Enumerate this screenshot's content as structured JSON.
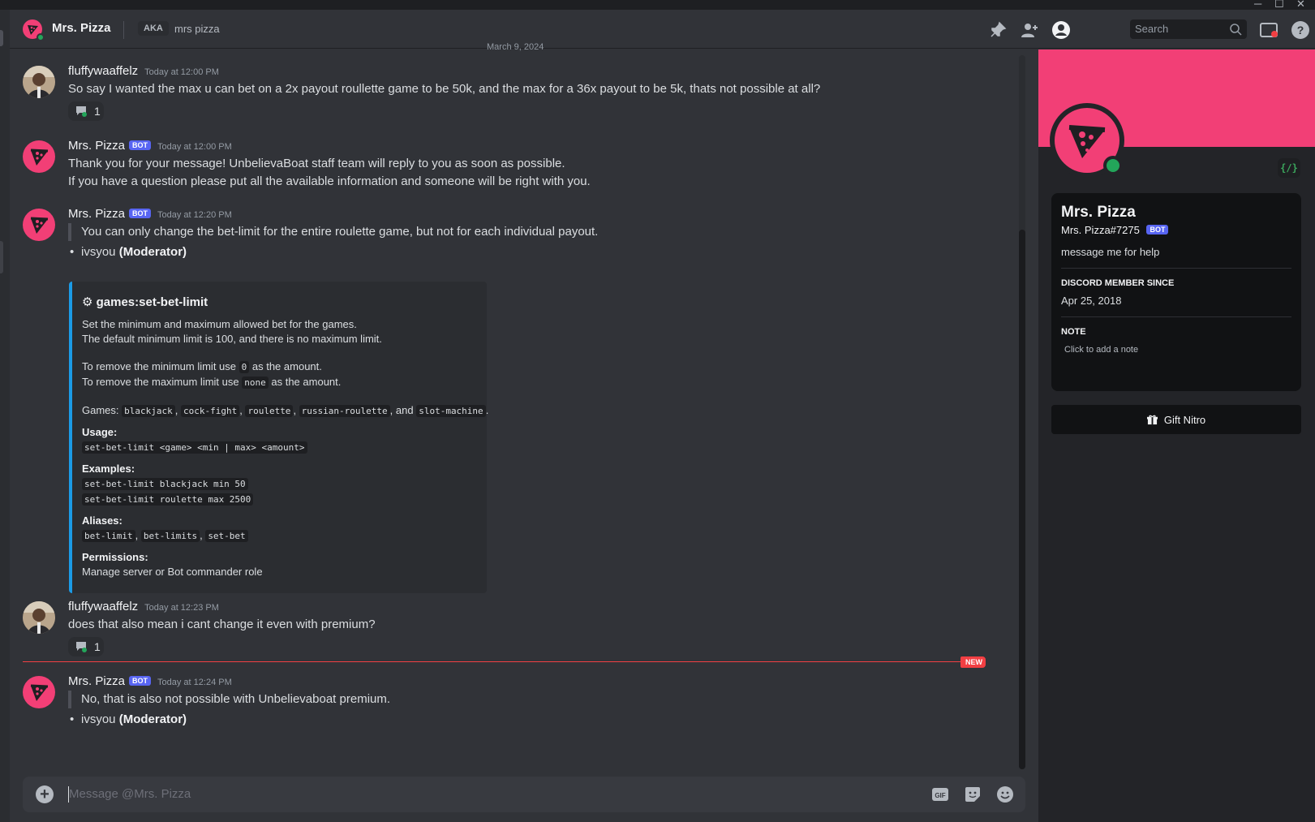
{
  "header": {
    "channel_name": "Mrs. Pizza",
    "aka_label": "AKA",
    "aka_name": "mrs pizza",
    "search_placeholder": "Search",
    "date_divider": "March 9, 2024"
  },
  "messages": [
    {
      "author": "fluffywaaffelz",
      "timestamp": "Today at 12:00 PM",
      "text": "So say I wanted the max u can bet on a 2x payout roullette game to be 50k, and the max for a 36x payout to be 5k, thats not possible at all?",
      "reaction_count": "1"
    },
    {
      "author": "Mrs. Pizza",
      "bot_badge": "BOT",
      "timestamp": "Today at 12:00 PM",
      "line1": "Thank you for your message! UnbelievaBoat staff team will reply to you as soon as possible.",
      "line2": "If you have a question please put all the available information and someone will be right with you."
    },
    {
      "author": "Mrs. Pizza",
      "bot_badge": "BOT",
      "timestamp": "Today at 12:20 PM",
      "quote": "You can only change the bet-limit for the entire roulette game, but not for each individual payout.",
      "signer": "ivsyou",
      "signer_role": "(Moderator)",
      "embed": {
        "title": "⚙ games:set-bet-limit",
        "desc1": "Set the minimum and maximum allowed bet for the games.",
        "desc2": "The default minimum limit is 100, and there is no maximum limit.",
        "remove_min_pre": "To remove the minimum limit use",
        "remove_min_code": "0",
        "remove_min_post": "as the amount.",
        "remove_max_pre": "To remove the maximum limit use",
        "remove_max_code": "none",
        "remove_max_post": "as the amount.",
        "games_label": "Games:",
        "games": [
          "blackjack",
          "cock-fight",
          "roulette",
          "russian-roulette",
          "slot-machine"
        ],
        "games_and": "and",
        "usage_label": "Usage:",
        "usage": "set-bet-limit <game> <min | max> <amount>",
        "examples_label": "Examples:",
        "examples": [
          "set-bet-limit blackjack min 50",
          "set-bet-limit roulette max 2500"
        ],
        "aliases_label": "Aliases:",
        "aliases": [
          "bet-limit",
          "bet-limits",
          "set-bet"
        ],
        "permissions_label": "Permissions:",
        "permissions": "Manage server or Bot commander role"
      }
    },
    {
      "author": "fluffywaaffelz",
      "timestamp": "Today at 12:23 PM",
      "text": "does that also mean i cant change it even with premium?",
      "reaction_count": "1"
    },
    {
      "author": "Mrs. Pizza",
      "bot_badge": "BOT",
      "timestamp": "Today at 12:24 PM",
      "quote": "No, that is also not possible with Unbelievaboat premium.",
      "signer": "ivsyou",
      "signer_role": "(Moderator)"
    }
  ],
  "new_marker": "NEW",
  "composer": {
    "placeholder": "Message @Mrs. Pizza",
    "gif_label": "GIF"
  },
  "profile": {
    "display_name": "Mrs. Pizza",
    "tag": "Mrs. Pizza#7275",
    "bot_badge": "BOT",
    "bio": "message me for help",
    "member_since_label": "DISCORD MEMBER SINCE",
    "member_since": "Apr 25, 2018",
    "note_label": "NOTE",
    "note_placeholder": "Click to add a note",
    "dev_badge": "{/}",
    "gift_button": "Gift Nitro"
  },
  "colors": {
    "brand_pink": "#f23f76",
    "online": "#23a55a",
    "blurple": "#5865f2",
    "embed_accent": "#1b9be6",
    "new_red": "#f23f43"
  },
  "icons": [
    "pin-icon",
    "add-friend-icon",
    "profile-icon",
    "search-icon",
    "inbox-icon",
    "help-icon",
    "thread-icon",
    "add-attachment-icon",
    "gif-icon",
    "sticker-icon",
    "emoji-icon",
    "gift-icon"
  ]
}
